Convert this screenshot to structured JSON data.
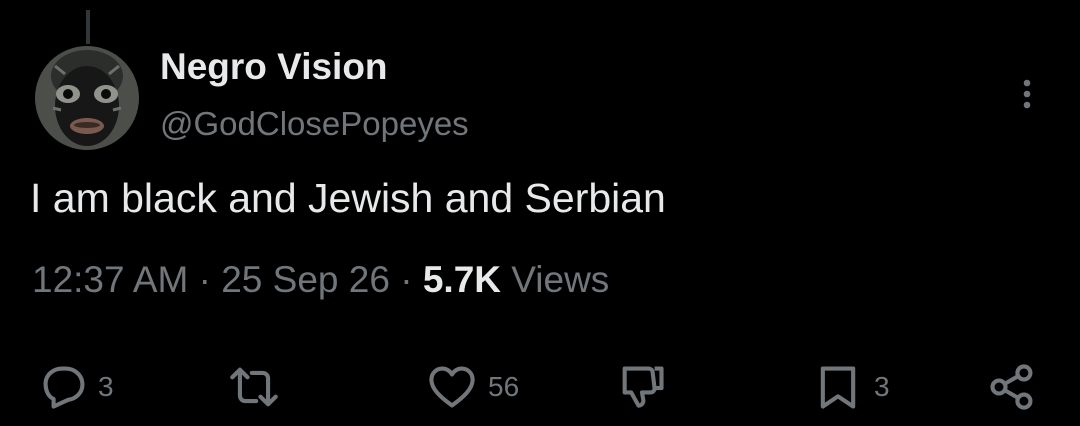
{
  "tweet": {
    "author": {
      "display_name": "Negro Vision",
      "handle": "@GodClosePopeyes"
    },
    "text": "I am black and Jewish and Serbian",
    "meta": {
      "time": "12:37 AM",
      "separator": "·",
      "date": "25 Sep 26",
      "views_count": "5.7K",
      "views_label": "Views"
    },
    "actions": {
      "replies": "3",
      "likes": "56",
      "bookmarks": "3"
    }
  },
  "icons": {
    "more": "more-vertical-icon",
    "reply": "reply-icon",
    "repost": "repost-icon",
    "like": "heart-icon",
    "dislike": "thumbs-down-icon",
    "bookmark": "bookmark-icon",
    "share": "share-icon"
  },
  "colors": {
    "background": "#000000",
    "primary_text": "#e7e9ea",
    "secondary_text": "#71767b",
    "thread_line": "#333639"
  }
}
